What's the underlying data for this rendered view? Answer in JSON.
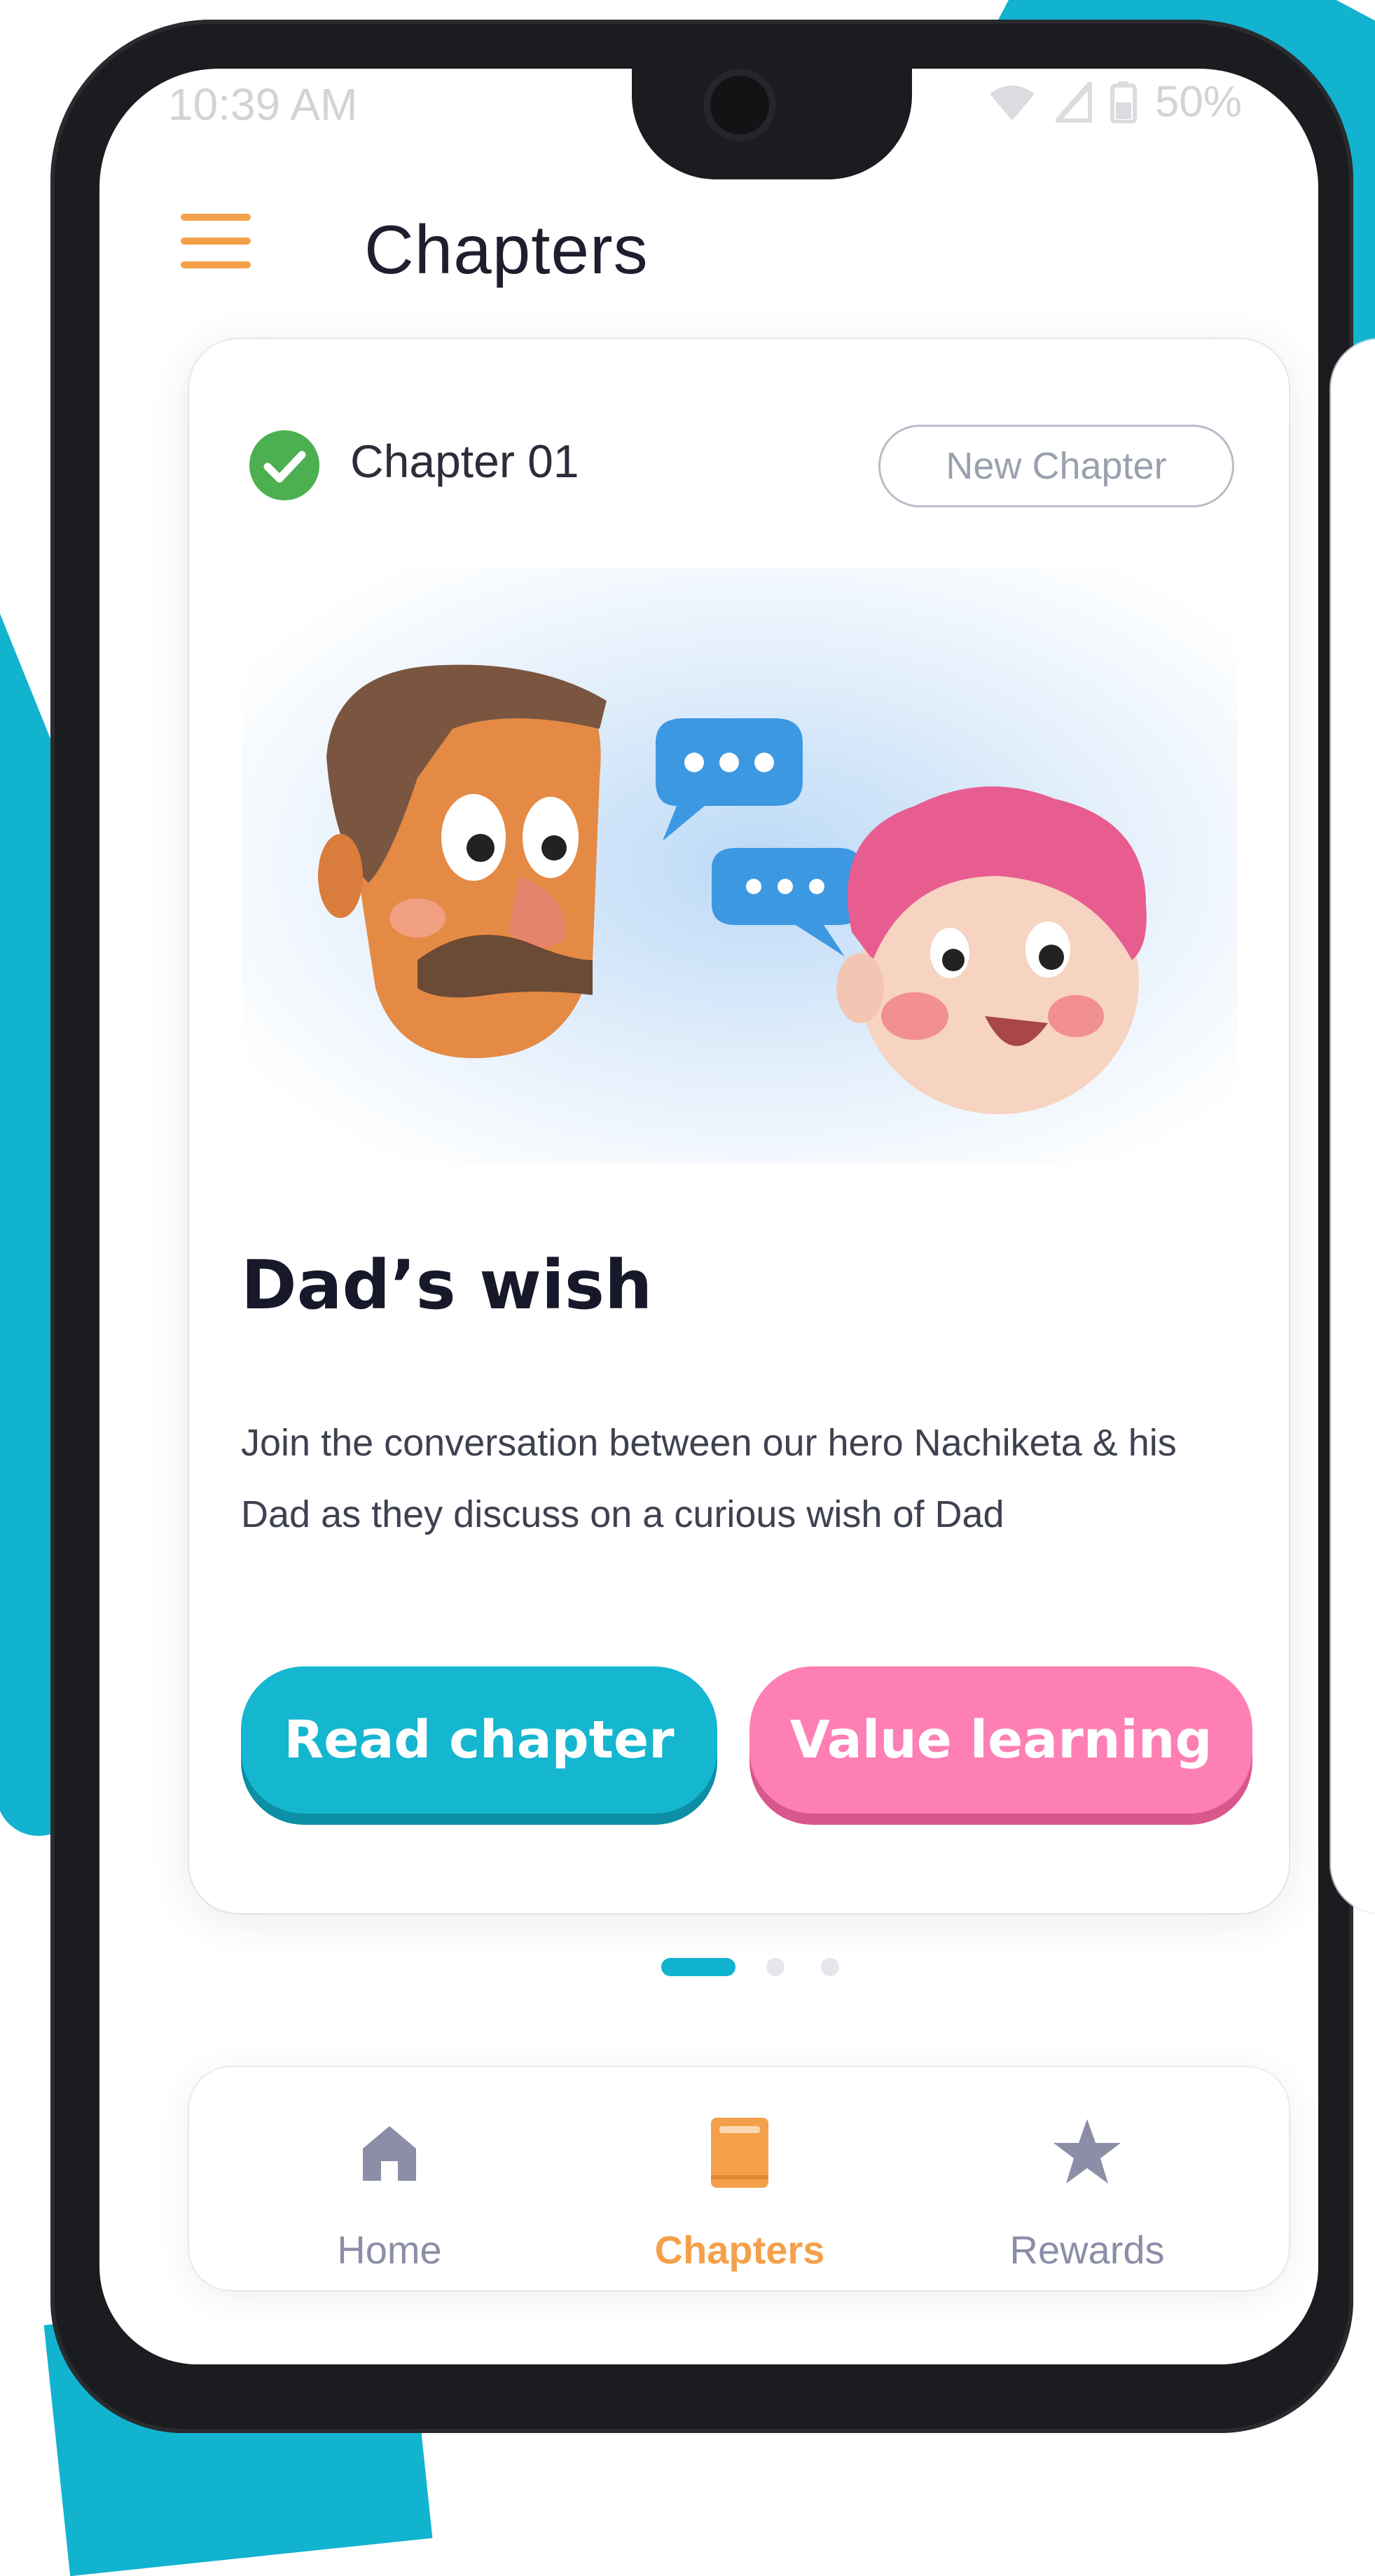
{
  "status_bar": {
    "time": "10:39 AM",
    "battery": "50%"
  },
  "header": {
    "title": "Chapters"
  },
  "card": {
    "chapter_label": "Chapter 01",
    "badge": "New Chapter",
    "title": "Dad’s wish",
    "description": "Join the conversation between our hero Nachiketa & his Dad as they discuss on a curious wish of Dad",
    "read_button": "Read chapter",
    "value_button": "Value learning"
  },
  "pager": {
    "total": 3,
    "active": 1
  },
  "bottom_nav": {
    "items": [
      {
        "label": "Home",
        "icon": "home-icon"
      },
      {
        "label": "Chapters",
        "icon": "book-icon",
        "active": true
      },
      {
        "label": "Rewards",
        "icon": "star-icon"
      }
    ]
  },
  "colors": {
    "accent_cyan": "#12b3cf",
    "accent_pink": "#fd7fb3",
    "accent_orange": "#f4a04a",
    "success_green": "#4caf50",
    "nav_inactive": "#8b8ea6"
  }
}
